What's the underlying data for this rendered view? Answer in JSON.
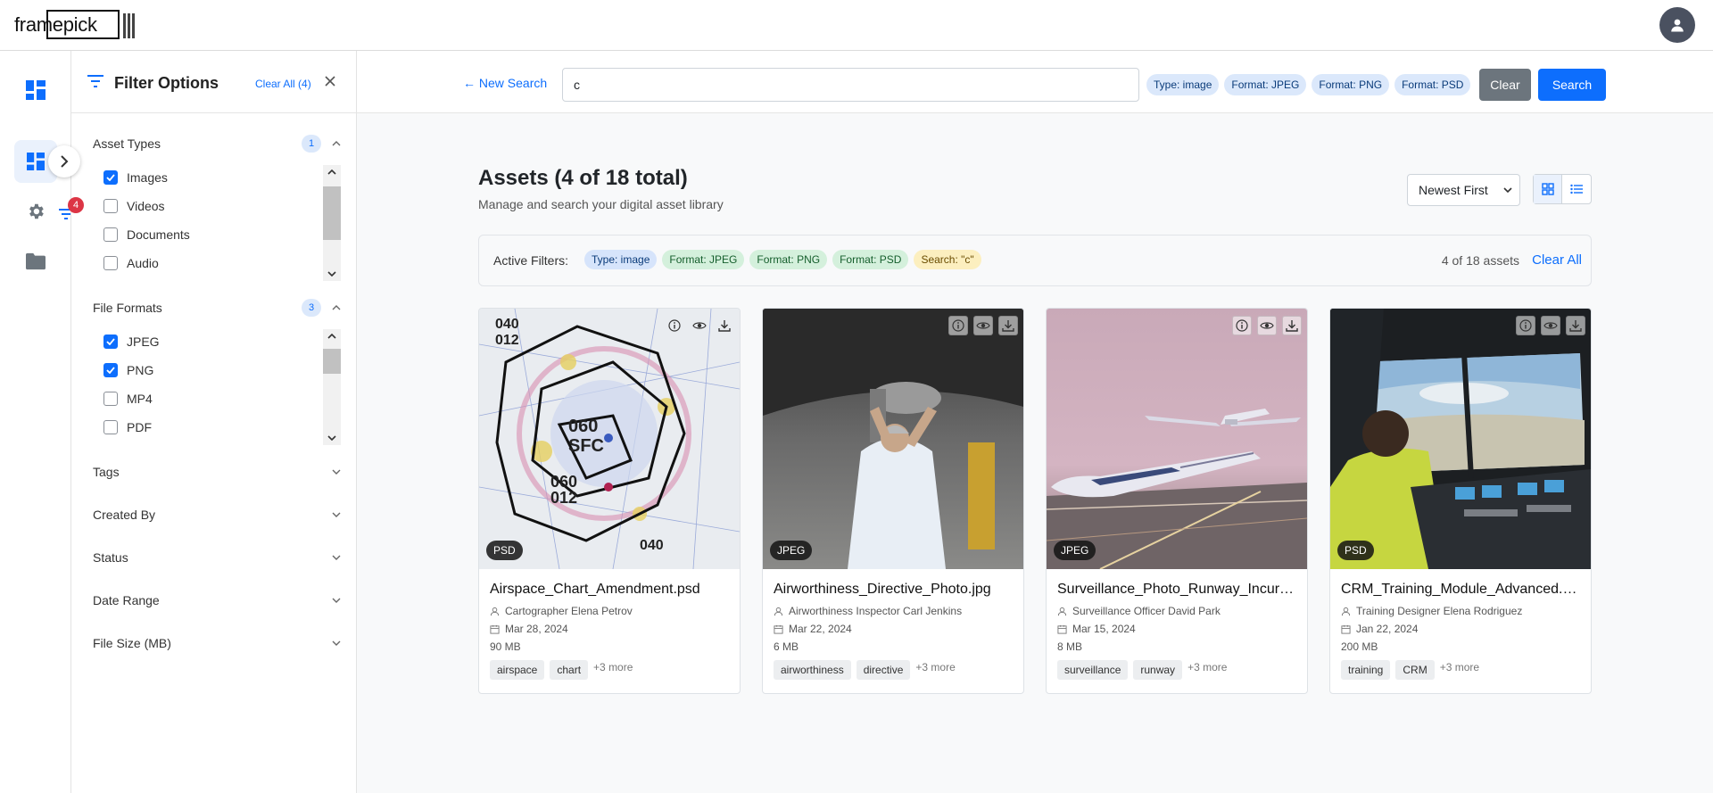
{
  "app": {
    "logo": "framepick"
  },
  "rail": {
    "filter_badge": "4"
  },
  "filters": {
    "title": "Filter Options",
    "clear_all": "Clear All (4)",
    "asset_types": {
      "label": "Asset Types",
      "count": "1",
      "options": [
        {
          "label": "Images",
          "checked": true
        },
        {
          "label": "Videos",
          "checked": false
        },
        {
          "label": "Documents",
          "checked": false
        },
        {
          "label": "Audio",
          "checked": false
        }
      ]
    },
    "file_formats": {
      "label": "File Formats",
      "count": "3",
      "options": [
        {
          "label": "JPEG",
          "checked": true
        },
        {
          "label": "PNG",
          "checked": true
        },
        {
          "label": "MP4",
          "checked": false
        },
        {
          "label": "PDF",
          "checked": false
        }
      ]
    },
    "collapsed_sections": [
      "Tags",
      "Created By",
      "Status",
      "Date Range",
      "File Size (MB)"
    ]
  },
  "search": {
    "new_search": "← New Search",
    "query": "c",
    "pills": [
      "Type: image",
      "Format: JPEG",
      "Format: PNG",
      "Format: PSD"
    ],
    "clear_label": "Clear",
    "search_label": "Search"
  },
  "main": {
    "title": "Assets (4 of 18 total)",
    "subtitle": "Manage and search your digital asset library",
    "sort": "Newest First",
    "active_filters_label": "Active Filters:",
    "active_filters": [
      {
        "label": "Type: image",
        "color": "blue"
      },
      {
        "label": "Format: JPEG",
        "color": "green"
      },
      {
        "label": "Format: PNG",
        "color": "green"
      },
      {
        "label": "Format: PSD",
        "color": "green"
      },
      {
        "label": "Search: \"c\"",
        "color": "yellow"
      }
    ],
    "result_count": "4 of 18 assets",
    "clear_all": "Clear All"
  },
  "assets": [
    {
      "name": "Airspace_Chart_Amendment.psd",
      "format": "PSD",
      "author": "Cartographer Elena Petrov",
      "date": "Mar 28, 2024",
      "size": "90 MB",
      "tags": [
        "airspace",
        "chart"
      ],
      "more": "+3 more"
    },
    {
      "name": "Airworthiness_Directive_Photo.jpg",
      "format": "JPEG",
      "author": "Airworthiness Inspector Carl Jenkins",
      "date": "Mar 22, 2024",
      "size": "6 MB",
      "tags": [
        "airworthiness",
        "directive"
      ],
      "more": "+3 more"
    },
    {
      "name": "Surveillance_Photo_Runway_Incursion.jpg",
      "format": "JPEG",
      "author": "Surveillance Officer David Park",
      "date": "Mar 15, 2024",
      "size": "8 MB",
      "tags": [
        "surveillance",
        "runway"
      ],
      "more": "+3 more"
    },
    {
      "name": "CRM_Training_Module_Advanced.psd",
      "format": "PSD",
      "author": "Training Designer Elena Rodriguez",
      "date": "Jan 22, 2024",
      "size": "200 MB",
      "tags": [
        "training",
        "CRM"
      ],
      "more": "+3 more"
    }
  ],
  "colors": {
    "primary": "#0d6efd",
    "secondary": "#6c757d",
    "danger": "#dc3545"
  }
}
